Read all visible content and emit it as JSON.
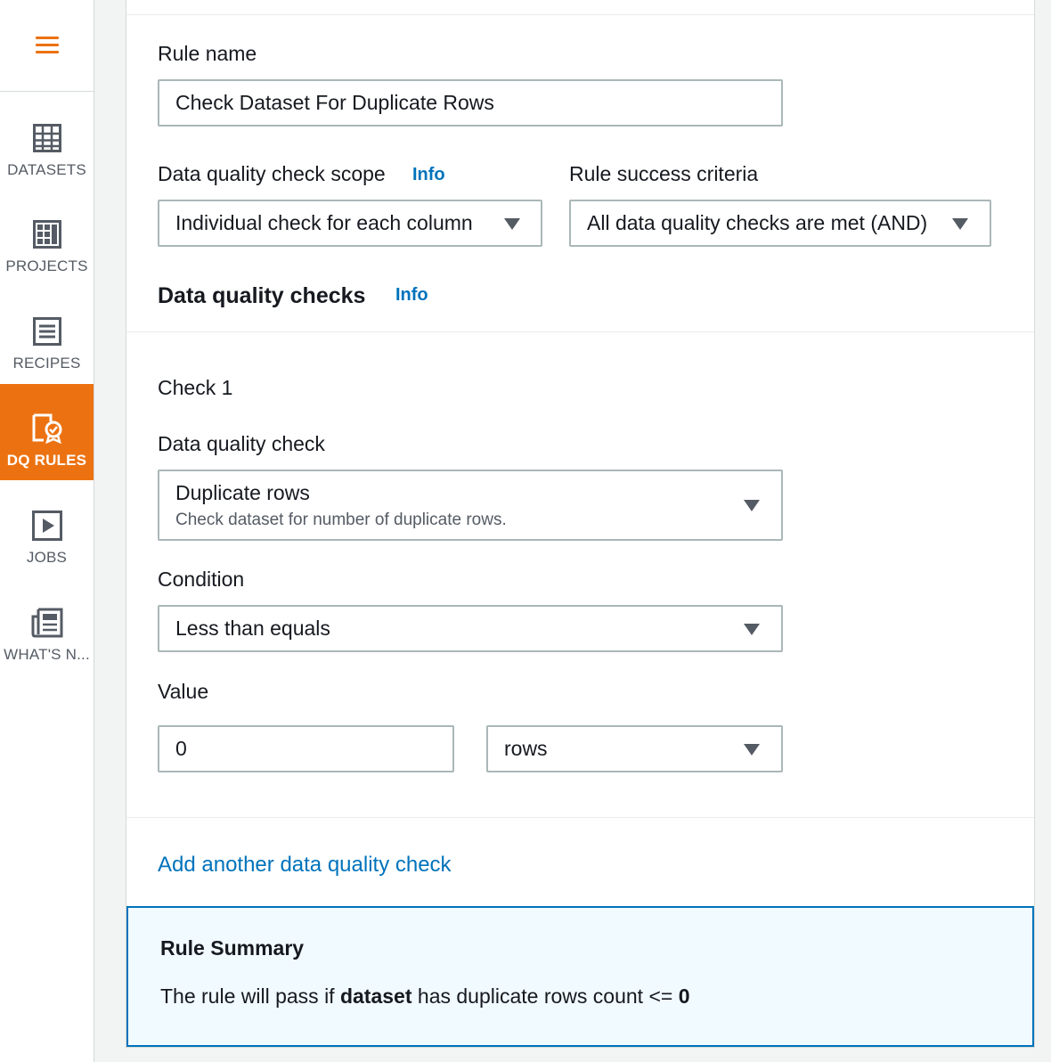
{
  "sidebar": {
    "menu_icon": "hamburger-icon",
    "accent_color": "#ec7211",
    "items": [
      {
        "label": "DATASETS",
        "icon": "table-grid-icon",
        "active": false
      },
      {
        "label": "PROJECTS",
        "icon": "project-grid-icon",
        "active": false
      },
      {
        "label": "RECIPES",
        "icon": "recipe-list-icon",
        "active": false
      },
      {
        "label": "DQ RULES",
        "icon": "dq-rules-icon",
        "active": true
      },
      {
        "label": "JOBS",
        "icon": "play-icon",
        "active": false
      },
      {
        "label": "WHAT'S N...",
        "icon": "news-icon",
        "active": false
      }
    ]
  },
  "form": {
    "rule_name_label": "Rule name",
    "rule_name_value": "Check Dataset For Duplicate Rows",
    "scope_label": "Data quality check scope",
    "scope_info": "Info",
    "scope_value": "Individual check for each column",
    "criteria_label": "Rule success criteria",
    "criteria_value": "All data quality checks are met (AND)",
    "checks_heading": "Data quality checks",
    "checks_info": "Info"
  },
  "check": {
    "title": "Check 1",
    "dq_check_label": "Data quality check",
    "dq_check_value": "Duplicate rows",
    "dq_check_description": "Check dataset for number of duplicate rows.",
    "condition_label": "Condition",
    "condition_value": "Less than equals",
    "value_label": "Value",
    "value_input": "0",
    "unit_value": "rows"
  },
  "add_check_link": "Add another data quality check",
  "summary": {
    "title": "Rule Summary",
    "text_prefix": "The rule will pass if ",
    "subject": "dataset",
    "text_middle": " has duplicate rows count <= ",
    "threshold": "0"
  },
  "colors": {
    "link": "#0073bb",
    "summary_background": "#f1faff",
    "summary_border": "#0073bb"
  }
}
